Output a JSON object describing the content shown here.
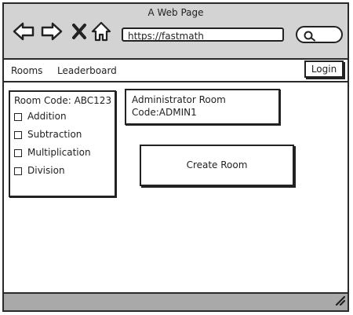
{
  "window": {
    "title": "A Web Page"
  },
  "browser": {
    "address": "https://fastmath",
    "icons": [
      "back-arrow-icon",
      "forward-arrow-icon",
      "close-icon",
      "home-icon",
      "search-icon"
    ]
  },
  "menu": {
    "items": [
      {
        "label": "Rooms"
      },
      {
        "label": "Leaderboard"
      }
    ],
    "login_label": "Login"
  },
  "room": {
    "code_label": "Room Code: ABC123",
    "operations": [
      {
        "label": "Addition",
        "checked": false
      },
      {
        "label": "Subtraction",
        "checked": false
      },
      {
        "label": "Multiplication",
        "checked": false
      },
      {
        "label": "Division",
        "checked": false
      }
    ]
  },
  "admin": {
    "line1": "Administrator Room",
    "line2": "Code:ADMIN1"
  },
  "actions": {
    "create_room_label": "Create Room"
  },
  "colors": {
    "titlebar": "#d3d3d3",
    "statusbar": "#a9a9a9",
    "stroke": "#222222"
  }
}
